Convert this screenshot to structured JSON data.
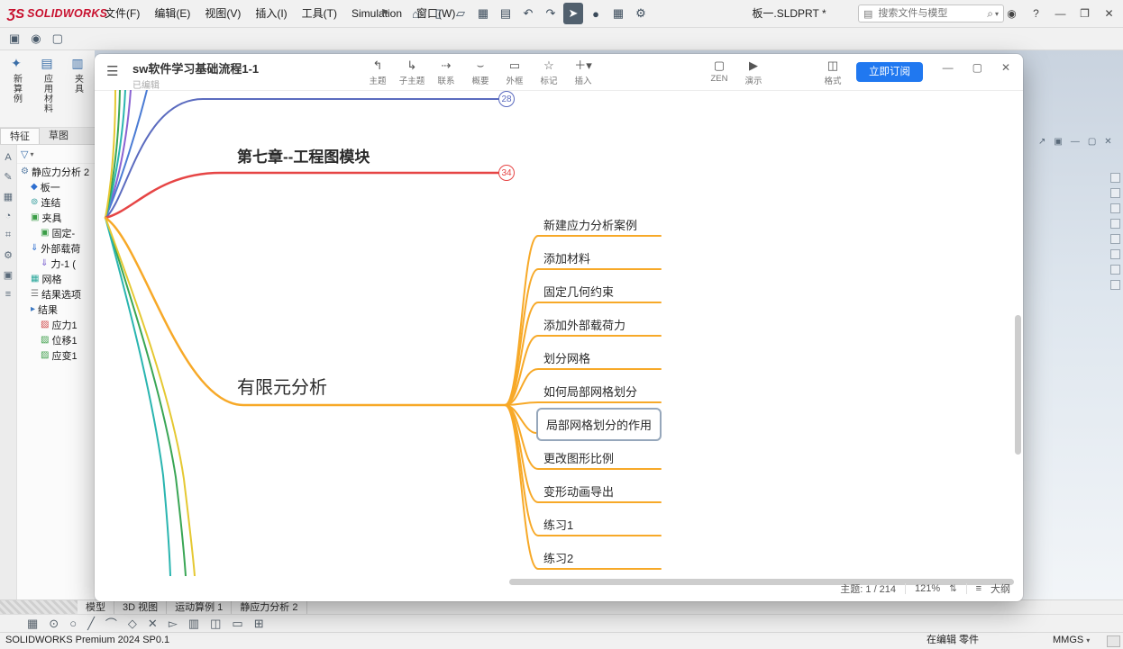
{
  "colors": {
    "accent_blue": "#2078f0",
    "branch_orange": "#f7a928",
    "branch_red": "#e64545",
    "badge_blue": "#5b6bbf",
    "logo_red": "#c8102e"
  },
  "topbar": {
    "logo_mark": "ƷS",
    "logo_text": "SOLIDWORKS",
    "menus": [
      "文件(F)",
      "编辑(E)",
      "视图(V)",
      "插入(I)",
      "工具(T)",
      "Simulation",
      "窗口(W)"
    ],
    "pin_icon": "⚑",
    "tool_icons": [
      "⌂",
      "▯",
      "▱",
      "▦",
      "▤",
      "↶",
      "↷",
      "➤",
      "●",
      "▦",
      "⚙"
    ],
    "doc_title": "板一.SLDPRT *",
    "search_placeholder": "搜索文件与模型",
    "search_doc_icon": "▤",
    "search_icon": "⌕",
    "search_caret": "▾",
    "user_icon": "◉",
    "help_icon": "?",
    "win_min": "—",
    "win_max": "❐",
    "win_close": "✕"
  },
  "quickbar_icons": [
    "▣",
    "◉",
    "▢"
  ],
  "command_buttons": [
    {
      "icon": "✦",
      "label": "新算例"
    },
    {
      "icon": "▤",
      "label": "应用材料"
    },
    {
      "icon": "▥",
      "label": "夹具"
    }
  ],
  "left_tabs": [
    "特征",
    "草图"
  ],
  "left_strip_icons": [
    "A",
    "✎",
    "▦",
    "◔",
    "⌗",
    "⚙",
    "▣",
    "≡"
  ],
  "tree": {
    "filter_icon": "▽",
    "filter_caret": "▾",
    "items": [
      {
        "icon": "⚙",
        "label": "静应力分析 2",
        "indent": 0,
        "color": "#5b7fa6"
      },
      {
        "icon": "◆",
        "label": "板一",
        "indent": 1,
        "color": "#2e6fd0"
      },
      {
        "icon": "⊚",
        "label": "连结",
        "indent": 1,
        "color": "#3aa0a0"
      },
      {
        "icon": "▣",
        "label": "夹具",
        "indent": 1,
        "color": "#3a9d46"
      },
      {
        "icon": "▣",
        "label": "固定-",
        "indent": 2,
        "color": "#3a9d46"
      },
      {
        "icon": "⇓",
        "label": "外部载荷",
        "indent": 1,
        "color": "#2e6fd0"
      },
      {
        "icon": "⇓",
        "label": "力-1 (",
        "indent": 2,
        "color": "#7a5fd0"
      },
      {
        "icon": "▦",
        "label": "网格",
        "indent": 1,
        "color": "#2aa79b"
      },
      {
        "icon": "☰",
        "label": "结果选项",
        "indent": 1,
        "color": "#777777"
      },
      {
        "icon": "▸",
        "label": "结果",
        "indent": 1,
        "color": "#3a77c2"
      },
      {
        "icon": "▨",
        "label": "应力1",
        "indent": 2,
        "color": "#d04545"
      },
      {
        "icon": "▨",
        "label": "位移1",
        "indent": 2,
        "color": "#3a9d46"
      },
      {
        "icon": "▨",
        "label": "应变1",
        "indent": 2,
        "color": "#3a9d46"
      }
    ]
  },
  "bottom_tabs": [
    "模型",
    "3D 视图",
    "运动算例 1",
    "静应力分析 2"
  ],
  "sketch_icons": [
    "▦",
    "⊙",
    "○",
    "╱",
    "⌒",
    "◇",
    "✕",
    "▻",
    "▥",
    "◫",
    "▭",
    "⊞"
  ],
  "statusbar": {
    "left": "SOLIDWORKS Premium 2024 SP0.1",
    "editing": "在编辑 零件",
    "units": "MMGS",
    "units_caret": "▾"
  },
  "dock_icons": [
    "↗",
    "▣",
    "—",
    "▢",
    "✕"
  ],
  "xmind": {
    "menu_icon": "☰",
    "title": "sw软件学习基础流程1-1",
    "subtitle": "已编辑",
    "toolbar": [
      {
        "icon": "↰",
        "label": "主题"
      },
      {
        "icon": "↳",
        "label": "子主题"
      },
      {
        "icon": "⇢",
        "label": "联系"
      },
      {
        "icon": "⌣",
        "label": "概要"
      },
      {
        "icon": "▭",
        "label": "外框"
      },
      {
        "icon": "☆",
        "label": "标记"
      },
      {
        "icon": "＋▾",
        "label": "插入"
      }
    ],
    "mode_buttons": [
      {
        "icon": "▢",
        "label": "ZEN"
      },
      {
        "icon": "▶",
        "label": "演示"
      }
    ],
    "format_button": {
      "icon": "◫",
      "label": "格式"
    },
    "subscribe_label": "立即订阅",
    "win_min": "—",
    "win_max": "▢",
    "win_close": "✕",
    "map": {
      "chapter7": "第七章--工程图模块",
      "badge28": "28",
      "badge34": "34",
      "fea": "有限元分析",
      "children": [
        "新建应力分析案例",
        "添加材料",
        "固定几何约束",
        "添加外部载荷力",
        "划分网格",
        "如何局部网格划分",
        "局部网格划分的作用",
        "更改图形比例",
        "变形动画导出",
        "练习1",
        "练习2"
      ]
    },
    "status": {
      "topics": "主题: 1 / 214",
      "zoom": "121%",
      "stepper": "⇅",
      "outline_icon": "≡",
      "outline": "大纲"
    }
  }
}
